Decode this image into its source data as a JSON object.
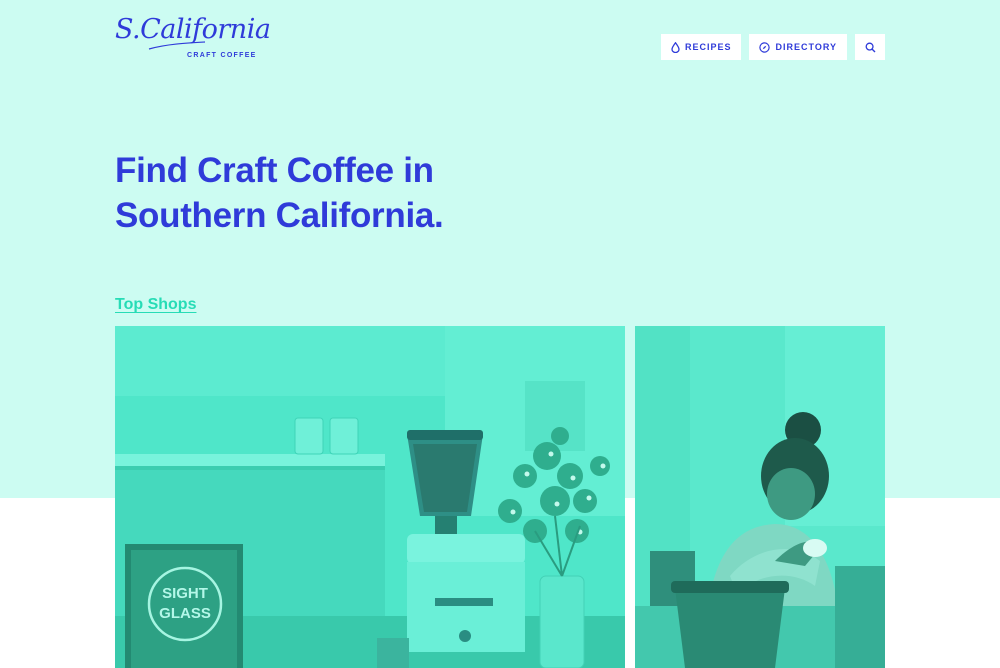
{
  "brand": {
    "logo_script": "S.California",
    "logo_sub": "CRAFT COFFEE",
    "color": "#2f3bd9"
  },
  "nav": {
    "recipes_label": "RECIPES",
    "directory_label": "DIRECTORY",
    "recipes_icon": "drop-icon",
    "directory_icon": "compass-icon",
    "search_icon": "search-icon"
  },
  "hero": {
    "headline_line1": "Find Craft Coffee in",
    "headline_line2": "Southern California.",
    "background": "#ccfcf2"
  },
  "shops": {
    "section_label": "Top Shops",
    "accent": "#27dcb6",
    "cards": [
      {
        "sign_line1": "SIGHT",
        "sign_line2": "GLASS"
      },
      {}
    ]
  }
}
